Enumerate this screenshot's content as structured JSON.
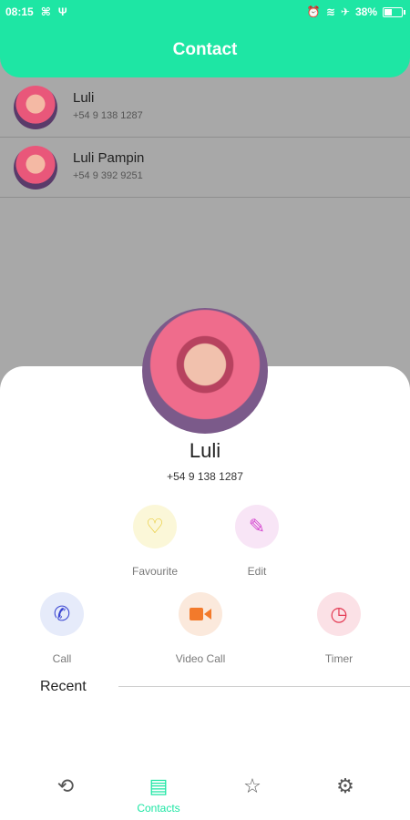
{
  "status_bar": {
    "time": "08:15",
    "battery_text": "38%",
    "battery_level": 0.38
  },
  "header": {
    "title": "Contact"
  },
  "contacts": [
    {
      "name": "Luli",
      "phone": "+54 9 138 1287"
    },
    {
      "name": "Luli Pampin",
      "phone": "+54 9 392 9251"
    }
  ],
  "detail": {
    "name": "Luli",
    "phone": "+54 9 138 1287",
    "actions": {
      "favourite": "Favourite",
      "edit": "Edit",
      "call": "Call",
      "video_call": "Video Call",
      "timer": "Timer"
    },
    "recent_label": "Recent"
  },
  "nav": {
    "contacts_label": "Contacts"
  },
  "colors": {
    "accent": "#1ee6a4",
    "overlay": "#a8a8a8"
  }
}
